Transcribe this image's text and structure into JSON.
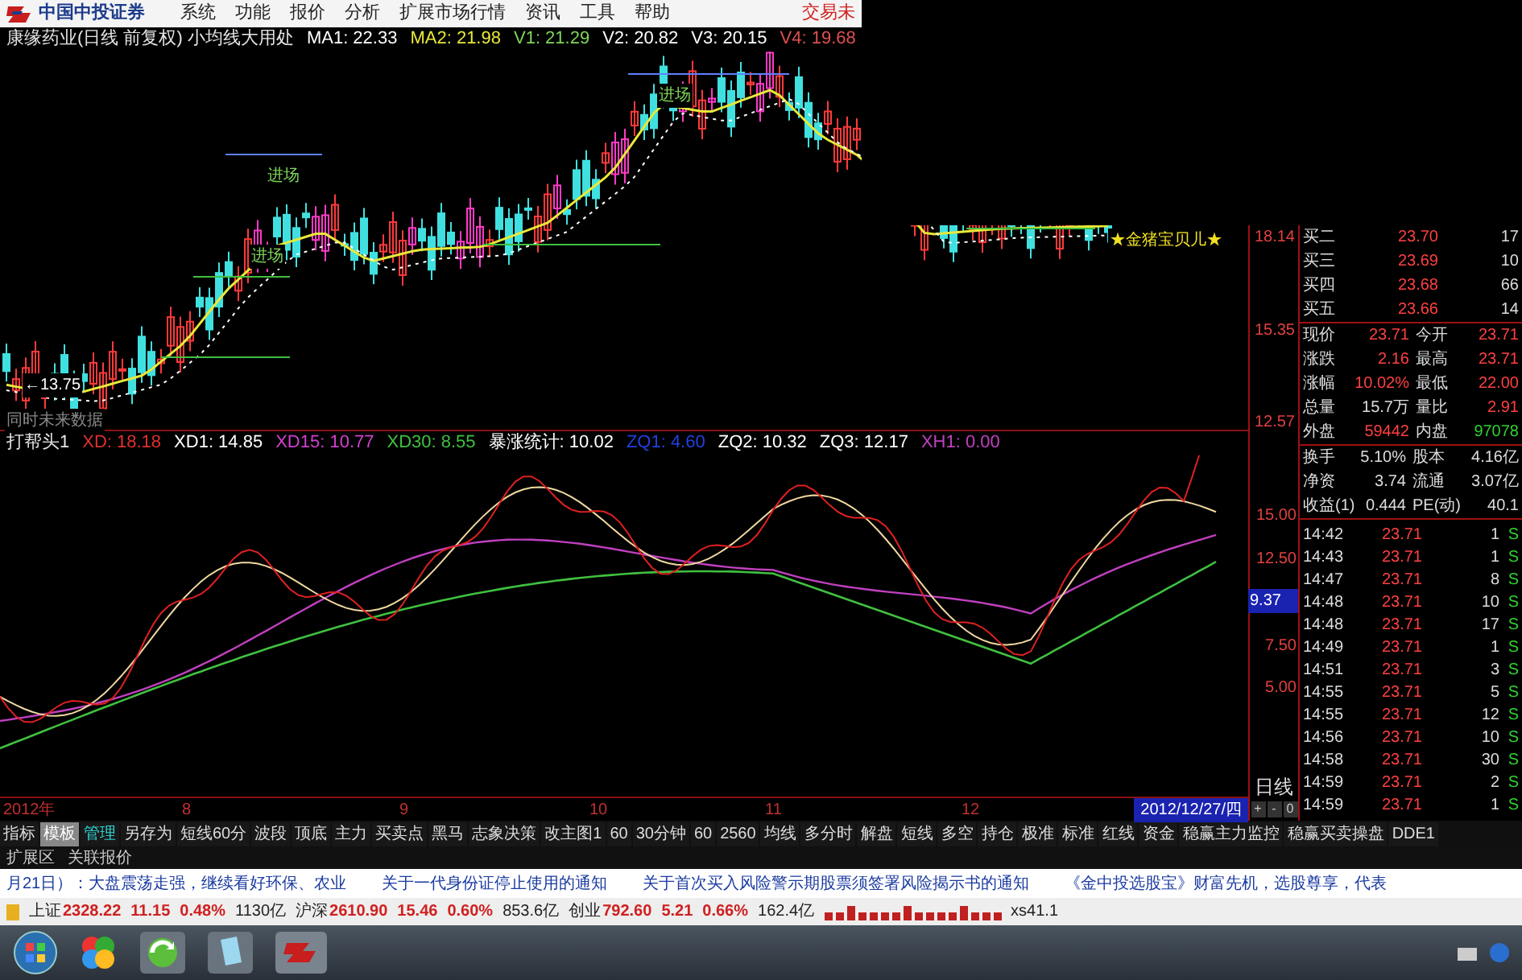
{
  "menu_bar": {
    "logo_text": "中国中投证券",
    "items": [
      "系统",
      "功能",
      "报价",
      "分析",
      "扩展市场行情",
      "资讯",
      "工具",
      "帮助"
    ],
    "trade_label": "交易未"
  },
  "main_chart": {
    "header": [
      {
        "text": "康缘药业(日线 前复权) 小均线大用处",
        "color": "#e5e5e5"
      },
      {
        "text": "MA1: 22.33",
        "color": "#ffffff"
      },
      {
        "text": "MA2: 21.98",
        "color": "#e8e83a"
      },
      {
        "text": "V1: 21.29",
        "color": "#7fd65a"
      },
      {
        "text": "V2: 20.82",
        "color": "#ffffff"
      },
      {
        "text": "V3: 20.15",
        "color": "#ffffff"
      },
      {
        "text": "V4: 19.68",
        "color": "#e05050"
      }
    ],
    "annotations": [
      {
        "text": "进场",
        "kind": "signal"
      },
      {
        "text": "进场",
        "kind": "signal"
      },
      {
        "text": "进场",
        "kind": "signal"
      },
      {
        "text": "←13.75",
        "kind": "low"
      },
      {
        "text": "★金猪宝贝儿★",
        "kind": "tag"
      },
      {
        "text": "同时未来数据",
        "kind": "note"
      }
    ],
    "price_labels": [
      "18.14",
      "15.35",
      "12.57"
    ]
  },
  "indicator": {
    "header": [
      {
        "text": "打帮头1",
        "color": "#e5e5e5"
      },
      {
        "text": "XD: 18.18",
        "color": "#e03030"
      },
      {
        "text": "XD1: 14.85",
        "color": "#ffffff"
      },
      {
        "text": "XD15: 10.77",
        "color": "#d040d0"
      },
      {
        "text": "XD30: 8.55",
        "color": "#40c040"
      },
      {
        "text": "暴涨统计: 10.02",
        "color": "#ffffff"
      },
      {
        "text": "ZQ1: 4.60",
        "color": "#2040e0"
      },
      {
        "text": "ZQ2: 10.32",
        "color": "#ffffff"
      },
      {
        "text": "ZQ3: 12.17",
        "color": "#ffffff"
      },
      {
        "text": "XH1: 0.00",
        "color": "#c040c0"
      }
    ],
    "axis_labels": [
      {
        "text": "15.00",
        "highlighted": false
      },
      {
        "text": "12.50",
        "highlighted": false
      },
      {
        "text": "9.37",
        "highlighted": true
      },
      {
        "text": "7.50",
        "highlighted": false
      },
      {
        "text": "5.00",
        "highlighted": false
      }
    ]
  },
  "time_axis": {
    "labels": [
      "2012年",
      "8",
      "9",
      "10",
      "11",
      "12"
    ],
    "current_date": "2012/12/27/四"
  },
  "period_label": "日线",
  "zoom_buttons": [
    "+",
    "-",
    "0"
  ],
  "tabs": [
    {
      "label": "指标",
      "selected": false,
      "kind": "plain"
    },
    {
      "label": "模板",
      "selected": true,
      "kind": "plain"
    },
    {
      "label": "管理",
      "selected": false,
      "kind": "accent"
    },
    {
      "label": "另存为",
      "selected": false,
      "kind": "plain"
    },
    {
      "label": "短线60分",
      "selected": false,
      "kind": "plain"
    },
    {
      "label": "波段",
      "selected": false,
      "kind": "plain"
    },
    {
      "label": "顶底",
      "selected": false,
      "kind": "plain"
    },
    {
      "label": "主力",
      "selected": false,
      "kind": "plain"
    },
    {
      "label": "买卖点",
      "selected": false,
      "kind": "plain"
    },
    {
      "label": "黑马",
      "selected": false,
      "kind": "plain"
    },
    {
      "label": "志象决策",
      "selected": false,
      "kind": "plain"
    },
    {
      "label": "改主图1",
      "selected": false,
      "kind": "plain"
    },
    {
      "label": "60",
      "selected": false,
      "kind": "plain"
    },
    {
      "label": "30分钟",
      "selected": false,
      "kind": "plain"
    },
    {
      "label": "60",
      "selected": false,
      "kind": "plain"
    },
    {
      "label": "2560",
      "selected": false,
      "kind": "plain"
    },
    {
      "label": "均线",
      "selected": false,
      "kind": "plain"
    },
    {
      "label": "多分时",
      "selected": false,
      "kind": "plain"
    },
    {
      "label": "解盘",
      "selected": false,
      "kind": "plain"
    },
    {
      "label": "短线",
      "selected": false,
      "kind": "plain"
    },
    {
      "label": "多空",
      "selected": false,
      "kind": "plain"
    },
    {
      "label": "持仓",
      "selected": false,
      "kind": "plain"
    },
    {
      "label": "极准",
      "selected": false,
      "kind": "plain"
    },
    {
      "label": "标准",
      "selected": false,
      "kind": "plain"
    },
    {
      "label": "红线",
      "selected": false,
      "kind": "plain"
    },
    {
      "label": "资金",
      "selected": false,
      "kind": "plain"
    },
    {
      "label": "稳赢主力监控",
      "selected": false,
      "kind": "plain"
    },
    {
      "label": "稳赢买卖操盘",
      "selected": false,
      "kind": "plain"
    },
    {
      "label": "DDE1",
      "selected": false,
      "kind": "plain"
    }
  ],
  "quote": {
    "order_book": [
      {
        "label": "买二",
        "price": "23.70",
        "volume": "17"
      },
      {
        "label": "买三",
        "price": "23.69",
        "volume": "10"
      },
      {
        "label": "买四",
        "price": "23.68",
        "volume": "66"
      },
      {
        "label": "买五",
        "price": "23.66",
        "volume": "14"
      }
    ],
    "stats": [
      [
        {
          "label": "现价",
          "value": "23.71",
          "color": "#ff4040"
        },
        {
          "label": "今开",
          "value": "23.71",
          "color": "#ff4040"
        }
      ],
      [
        {
          "label": "涨跌",
          "value": "2.16",
          "color": "#ff4040"
        },
        {
          "label": "最高",
          "value": "23.71",
          "color": "#ff4040"
        }
      ],
      [
        {
          "label": "涨幅",
          "value": "10.02%",
          "color": "#ff4040"
        },
        {
          "label": "最低",
          "value": "22.00",
          "color": "#ff4040"
        }
      ],
      [
        {
          "label": "总量",
          "value": "15.7万",
          "color": "#dddddd"
        },
        {
          "label": "量比",
          "value": "2.91",
          "color": "#ff4040"
        }
      ],
      [
        {
          "label": "外盘",
          "value": "59442",
          "color": "#ff4040"
        },
        {
          "label": "内盘",
          "value": "97078",
          "color": "#30d030"
        }
      ]
    ],
    "fundamentals": [
      [
        {
          "label": "换手",
          "value": "5.10%"
        },
        {
          "label": "股本",
          "value": "4.16亿"
        }
      ],
      [
        {
          "label": "净资",
          "value": "3.74"
        },
        {
          "label": "流通",
          "value": "3.07亿"
        }
      ],
      [
        {
          "label": "收益(1)",
          "value": "0.444"
        },
        {
          "label": "PE(动)",
          "value": "40.1"
        }
      ]
    ]
  },
  "ticks": [
    {
      "time": "14:42",
      "price": "23.71",
      "volume": "1",
      "side": "S"
    },
    {
      "time": "14:43",
      "price": "23.71",
      "volume": "1",
      "side": "S"
    },
    {
      "time": "14:47",
      "price": "23.71",
      "volume": "8",
      "side": "S"
    },
    {
      "time": "14:48",
      "price": "23.71",
      "volume": "10",
      "side": "S"
    },
    {
      "time": "14:48",
      "price": "23.71",
      "volume": "17",
      "side": "S"
    },
    {
      "time": "14:49",
      "price": "23.71",
      "volume": "1",
      "side": "S"
    },
    {
      "time": "14:51",
      "price": "23.71",
      "volume": "3",
      "side": "S"
    },
    {
      "time": "14:55",
      "price": "23.71",
      "volume": "5",
      "side": "S"
    },
    {
      "time": "14:55",
      "price": "23.71",
      "volume": "12",
      "side": "S"
    },
    {
      "time": "14:56",
      "price": "23.71",
      "volume": "10",
      "side": "S"
    },
    {
      "time": "14:58",
      "price": "23.71",
      "volume": "30",
      "side": "S"
    },
    {
      "time": "14:59",
      "price": "23.71",
      "volume": "2",
      "side": "S"
    },
    {
      "time": "14:59",
      "price": "23.71",
      "volume": "1",
      "side": "S"
    }
  ],
  "extension_tabs": [
    "扩展区",
    "关联报价"
  ],
  "news": [
    "月21日）：大盘震荡走强，继续看好环保、农业",
    "关于一代身份证停止使用的通知",
    "关于首次买入风险警示期股票须签署风险揭示书的通知",
    "《金中投选股宝》财富先机，选股尊享，代表"
  ],
  "index_bar": {
    "indices": [
      {
        "name": "上证",
        "value": "2328.22",
        "change": "11.15",
        "percent": "0.48%",
        "amount": "1130亿"
      },
      {
        "name": "沪深",
        "value": "2610.90",
        "change": "15.46",
        "percent": "0.60%",
        "amount": "853.6亿"
      },
      {
        "name": "创业",
        "value": "792.60",
        "change": "5.21",
        "percent": "0.66%",
        "amount": "162.4亿"
      }
    ],
    "extra": "xs41.1"
  }
}
